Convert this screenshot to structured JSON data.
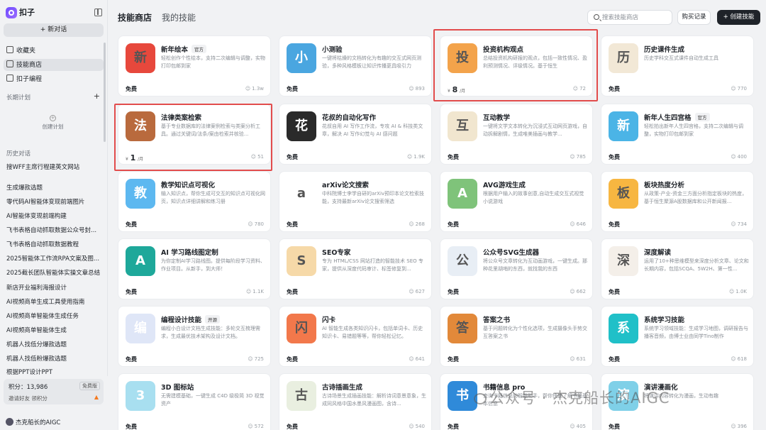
{
  "app": {
    "name": "扣子"
  },
  "sidebar": {
    "new_chat": "+ 新对话",
    "nav": [
      {
        "label": "收藏夹",
        "icon": "folder-icon"
      },
      {
        "label": "技能商店",
        "icon": "store-icon"
      },
      {
        "label": "扣子编程",
        "icon": "code-icon"
      }
    ],
    "plans_label": "长期计划",
    "create_plan": "创建计划",
    "history_label": "历史对话",
    "history": [
      "搜WFF主席行程建英文网站",
      "生成爆款选题",
      "零代码AI智能体变现前端图片",
      "AI智能体变现前端构建",
      "飞书表格自动抓取数据公众号封...",
      "飞书表格自动抓取数据教程",
      "2025智能体工作流RPA文案及图...",
      "2025截长团队智能体实操文章总结",
      "新店开业福利海报设计",
      "AI视频商单生成工具使用指南",
      "AI视频商单智能体生成任务",
      "AI视频商单智能体生成",
      "机器人找低分爆款选题",
      "机器人找低粉爆款选题",
      "根据PPT设计PPT"
    ],
    "points": "积分：13,986",
    "plan_badge": "免费版",
    "invite": "邀请好友 领积分",
    "user": "杰克船长的AIGC"
  },
  "header": {
    "tab_store": "技能商店",
    "tab_mine": "我的技能",
    "search_placeholder": "搜索技能商店",
    "records": "购买记录",
    "create": "+ 创建技能"
  },
  "cards": [
    {
      "title": "新年绘本",
      "badge": "官方",
      "desc": "轻松创作个性绘本，支持二次编辑与调整，实物打印包邮到家",
      "price": "免费",
      "uses": "1.3w",
      "color": "#e7483c"
    },
    {
      "title": "小测验",
      "badge": "",
      "desc": "一键将枯燥的文档转化为有趣的交互式网页测验，多种风格模板让知识传播更具吸引力",
      "price": "免费",
      "uses": "893",
      "color": "#4aa6e0"
    },
    {
      "title": "投资机构观点",
      "badge": "",
      "desc": "总结投资机构研报的观点，包括一致性情况、盈利预测情况、评级情况。基于恒生",
      "price_symbol": "¥",
      "price_num": "8",
      "price_unit": "/月",
      "uses": "72",
      "color": "#f3a34b"
    },
    {
      "title": "历史课件生成",
      "badge": "",
      "desc": "历史学科交互式课件自动生成工具",
      "price": "免费",
      "uses": "770",
      "color": "#f2e8d6"
    },
    {
      "title": "法律类案检索",
      "badge": "",
      "desc": "基于专业数据库的法律案例检索与类案分析工具。通过关键词/法条/案由检索并核验...",
      "price_symbol": "¥",
      "price_num": "1",
      "price_unit": "/月",
      "uses": "51",
      "color": "#b96a3d"
    },
    {
      "title": "花叔的自动化写作",
      "badge": "",
      "desc": "花叔自用 AI 写作工作流，专攻 AI & 科技类文章，解决 AI 写作幻觉与 AI 感问题",
      "price": "免费",
      "uses": "1.9K",
      "color": "#2a2a2a"
    },
    {
      "title": "互动教学",
      "badge": "",
      "desc": "一键将文学文本转化为沉浸式互动网页游戏，自动拆解剧情，生成唯美插画与教学...",
      "price": "免费",
      "uses": "785",
      "color": "#f1e6cf"
    },
    {
      "title": "新年人生四宫格",
      "badge": "官方",
      "desc": "轻松拍出新年人生四宫格，支持二次编辑与调整，实物打印包邮到家",
      "price": "免费",
      "uses": "400",
      "color": "#4bb4e6"
    },
    {
      "title": "教学知识点可视化",
      "badge": "",
      "desc": "输入知识点，帮你生成可交互的知识点可视化网页，知识点详细讲解和练习册",
      "price": "免费",
      "uses": "780",
      "color": "#5db8f0"
    },
    {
      "title": "arXiv论文搜索",
      "badge": "",
      "desc": "中科院博士李学自研的arXiv预印本论文检索技能，支持最新arXiv论文搜索筛选",
      "price": "免费",
      "uses": "268",
      "color": "#ffffff"
    },
    {
      "title": "AVG游戏生成",
      "badge": "",
      "desc": "根据用户输入的故事创意,自动生成交互式视觉小说游戏",
      "price": "免费",
      "uses": "646",
      "color": "#7fc37a"
    },
    {
      "title": "板块热度分析",
      "badge": "",
      "desc": "从政策-产业-资金三方面分析指定板块的热度，基于恒生聚源A股数据库和公开新闻报...",
      "price": "免费",
      "uses": "734",
      "color": "#f7b641"
    },
    {
      "title": "AI 学习路线图定制",
      "badge": "",
      "desc": "为你定制AI学习路线图。提供每阶段学习资料、作业项目。从新手，到大师！",
      "price": "免费",
      "uses": "1.1K",
      "color": "#1ea89a"
    },
    {
      "title": "SEO专家",
      "badge": "",
      "desc": "专为 HTML/CSS 网站打造的智能技术 SEO 专家，提供从深度代码审计、标签修复到...",
      "price": "免费",
      "uses": "627",
      "color": "#f6d9a8"
    },
    {
      "title": "公众号SVG生成器",
      "badge": "",
      "desc": "将公众号文章转化为互动画游戏，一键生成。那种花里胡哨的东西，就找我的东西",
      "price": "免费",
      "uses": "662",
      "color": "#e8eef5"
    },
    {
      "title": "深度解读",
      "badge": "",
      "desc": "运用了10+种思维模型来深度分析文章、论文和长期内容，包括SCQA、5W2H、第一性...",
      "price": "免费",
      "uses": "1.0K",
      "color": "#f4efe9"
    },
    {
      "title": "编程设计技能",
      "badge": "开源",
      "desc": "编程小白设计文档生成技能：多轮交互梳理需求，生成最优技术架构及设计文档。",
      "price": "免费",
      "uses": "725",
      "color": "#dfe6f7"
    },
    {
      "title": "闪卡",
      "badge": "",
      "desc": "AI 智能生成各类知识闪卡，包括单词卡、历史知识卡、易错题等等，帮你轻松记忆。",
      "price": "免费",
      "uses": "641",
      "color": "#f2784b"
    },
    {
      "title": "答案之书",
      "badge": "",
      "desc": "基于问题转化为个性化选项，生成摄像头手势交互答案之书",
      "price": "免费",
      "uses": "631",
      "color": "#e2893a"
    },
    {
      "title": "系统学习技能",
      "badge": "",
      "desc": "系统学习领域技能：生成学习地图，调研报告与播客音频，由博士业由同学Tino制作",
      "price": "免费",
      "uses": "618",
      "color": "#20c0c8"
    },
    {
      "title": "3D 图标站",
      "badge": "",
      "desc": "无需建模基础，一键生成 C4D 级极简 3D 视觉资产",
      "price": "免费",
      "uses": "572",
      "color": "#a8dff0"
    },
    {
      "title": "古诗插画生成",
      "badge": "",
      "desc": "古诗场景生成插画技能：解析诗词意景意象，生成同风格中国水墨风漫画图，含诗...",
      "price": "免费",
      "uses": "540",
      "color": "#e9efe0"
    },
    {
      "title": "书籍信息 pro",
      "badge": "",
      "desc": "查询书籍信息的智能助手，帮你快速了解书籍基本信息",
      "price": "免费",
      "uses": "405",
      "color": "#2f8ad9"
    },
    {
      "title": "演讲漫画化",
      "badge": "",
      "desc": "将演讲内容转化为漫画，生动有趣",
      "price": "免费",
      "uses": "396",
      "color": "#7fd0e8"
    }
  ],
  "watermark": "公众号 · 杰克船长的AIGC"
}
